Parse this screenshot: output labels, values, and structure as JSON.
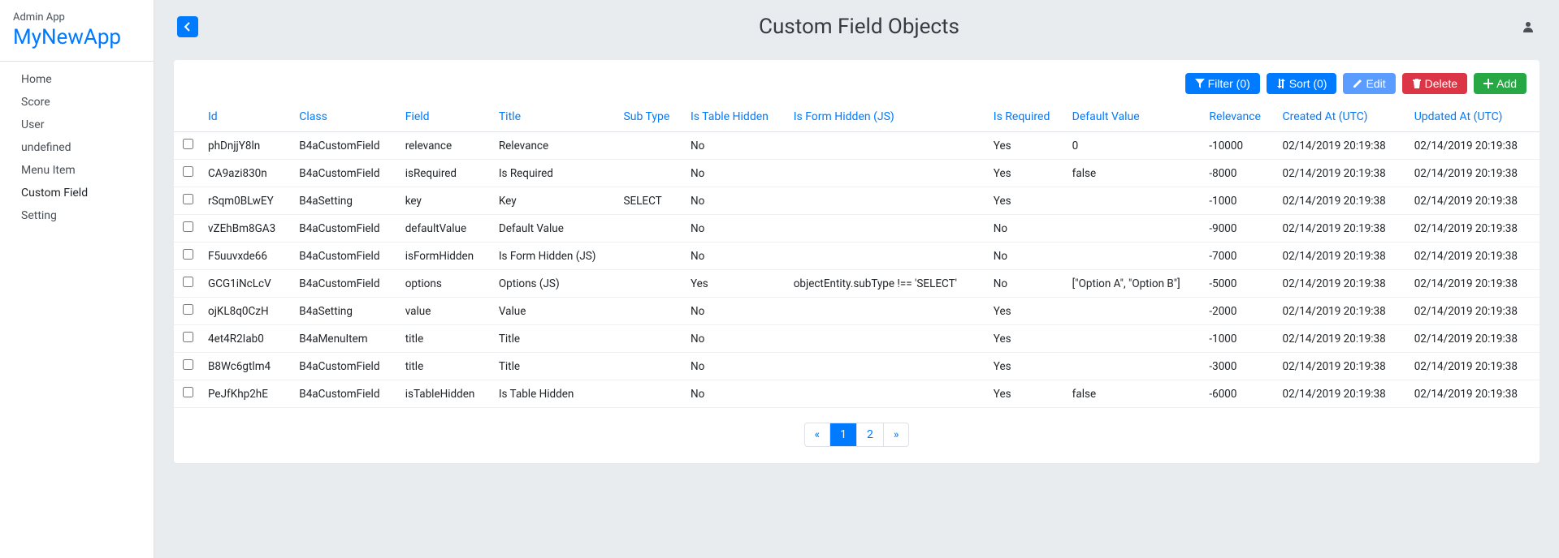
{
  "sidebar": {
    "admin_label": "Admin App",
    "app_name": "MyNewApp",
    "items": [
      {
        "label": "Home",
        "active": false
      },
      {
        "label": "Score",
        "active": false
      },
      {
        "label": "User",
        "active": false
      },
      {
        "label": "undefined",
        "active": false
      },
      {
        "label": "Menu Item",
        "active": false
      },
      {
        "label": "Custom Field",
        "active": true
      },
      {
        "label": "Setting",
        "active": false
      }
    ]
  },
  "header": {
    "title": "Custom Field Objects"
  },
  "toolbar": {
    "filter_label": "Filter (0)",
    "sort_label": "Sort (0)",
    "edit_label": "Edit",
    "delete_label": "Delete",
    "add_label": "Add"
  },
  "table": {
    "columns": [
      "Id",
      "Class",
      "Field",
      "Title",
      "Sub Type",
      "Is Table Hidden",
      "Is Form Hidden (JS)",
      "Is Required",
      "Default Value",
      "Relevance",
      "Created At (UTC)",
      "Updated At (UTC)"
    ],
    "rows": [
      {
        "id": "phDnjjY8ln",
        "class_": "B4aCustomField",
        "field": "relevance",
        "title": "Relevance",
        "subtype": "",
        "is_table_hidden": "No",
        "is_form_hidden": "",
        "is_required": "Yes",
        "default_value": "0",
        "relevance": "-10000",
        "created_at": "02/14/2019 20:19:38",
        "updated_at": "02/14/2019 20:19:38"
      },
      {
        "id": "CA9azi830n",
        "class_": "B4aCustomField",
        "field": "isRequired",
        "title": "Is Required",
        "subtype": "",
        "is_table_hidden": "No",
        "is_form_hidden": "",
        "is_required": "Yes",
        "default_value": "false",
        "relevance": "-8000",
        "created_at": "02/14/2019 20:19:38",
        "updated_at": "02/14/2019 20:19:38"
      },
      {
        "id": "rSqm0BLwEY",
        "class_": "B4aSetting",
        "field": "key",
        "title": "Key",
        "subtype": "SELECT",
        "is_table_hidden": "No",
        "is_form_hidden": "",
        "is_required": "Yes",
        "default_value": "",
        "relevance": "-1000",
        "created_at": "02/14/2019 20:19:38",
        "updated_at": "02/14/2019 20:19:38"
      },
      {
        "id": "vZEhBm8GA3",
        "class_": "B4aCustomField",
        "field": "defaultValue",
        "title": "Default Value",
        "subtype": "",
        "is_table_hidden": "No",
        "is_form_hidden": "",
        "is_required": "No",
        "default_value": "",
        "relevance": "-9000",
        "created_at": "02/14/2019 20:19:38",
        "updated_at": "02/14/2019 20:19:38"
      },
      {
        "id": "F5uuvxde66",
        "class_": "B4aCustomField",
        "field": "isFormHidden",
        "title": "Is Form Hidden (JS)",
        "subtype": "",
        "is_table_hidden": "No",
        "is_form_hidden": "",
        "is_required": "No",
        "default_value": "",
        "relevance": "-7000",
        "created_at": "02/14/2019 20:19:38",
        "updated_at": "02/14/2019 20:19:38"
      },
      {
        "id": "GCG1iNcLcV",
        "class_": "B4aCustomField",
        "field": "options",
        "title": "Options (JS)",
        "subtype": "",
        "is_table_hidden": "Yes",
        "is_form_hidden": "objectEntity.subType !== 'SELECT'",
        "is_required": "No",
        "default_value": "[\"Option A\", \"Option B\"]",
        "relevance": "-5000",
        "created_at": "02/14/2019 20:19:38",
        "updated_at": "02/14/2019 20:19:38"
      },
      {
        "id": "ojKL8q0CzH",
        "class_": "B4aSetting",
        "field": "value",
        "title": "Value",
        "subtype": "",
        "is_table_hidden": "No",
        "is_form_hidden": "",
        "is_required": "Yes",
        "default_value": "",
        "relevance": "-2000",
        "created_at": "02/14/2019 20:19:38",
        "updated_at": "02/14/2019 20:19:38"
      },
      {
        "id": "4et4R2Iab0",
        "class_": "B4aMenuItem",
        "field": "title",
        "title": "Title",
        "subtype": "",
        "is_table_hidden": "No",
        "is_form_hidden": "",
        "is_required": "Yes",
        "default_value": "",
        "relevance": "-1000",
        "created_at": "02/14/2019 20:19:38",
        "updated_at": "02/14/2019 20:19:38"
      },
      {
        "id": "B8Wc6gtlm4",
        "class_": "B4aCustomField",
        "field": "title",
        "title": "Title",
        "subtype": "",
        "is_table_hidden": "No",
        "is_form_hidden": "",
        "is_required": "Yes",
        "default_value": "",
        "relevance": "-3000",
        "created_at": "02/14/2019 20:19:38",
        "updated_at": "02/14/2019 20:19:38"
      },
      {
        "id": "PeJfKhp2hE",
        "class_": "B4aCustomField",
        "field": "isTableHidden",
        "title": "Is Table Hidden",
        "subtype": "",
        "is_table_hidden": "No",
        "is_form_hidden": "",
        "is_required": "Yes",
        "default_value": "false",
        "relevance": "-6000",
        "created_at": "02/14/2019 20:19:38",
        "updated_at": "02/14/2019 20:19:38"
      }
    ]
  },
  "pagination": {
    "prev": "«",
    "next": "»",
    "pages": [
      "1",
      "2"
    ],
    "active": "1"
  }
}
